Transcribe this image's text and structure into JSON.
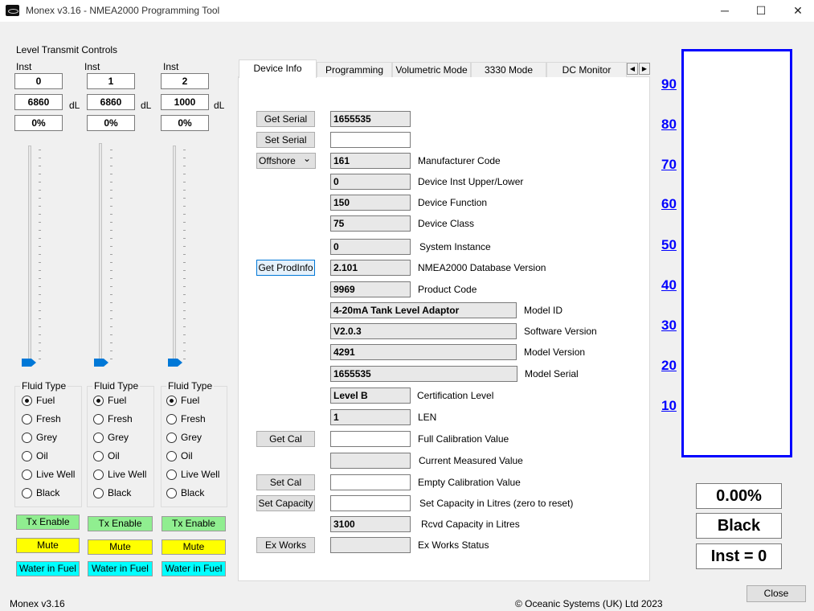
{
  "window": {
    "title": "Monex v3.16 - NMEA2000 Programming Tool",
    "minimize_glyph": "─",
    "maximize_glyph": "☐",
    "close_glyph": "✕"
  },
  "left": {
    "group_title": "Level Transmit Controls",
    "inst_label": "Inst",
    "unit_label": "dL",
    "fluid_type_label": "Fluid Type",
    "fluid_options": [
      "Fuel",
      "Fresh",
      "Grey",
      "Oil",
      "Live Well",
      "Black"
    ],
    "tx_enable_label": "Tx Enable",
    "mute_label": "Mute",
    "water_in_fuel_label": "Water in Fuel",
    "colors": {
      "tx_enable": "#90ee90",
      "mute": "#ffff00",
      "water_in_fuel": "#00ffff"
    },
    "channels": [
      {
        "inst": "0",
        "capacity": "6860",
        "level": "0%",
        "slider_fraction": 0,
        "fluid": "Fuel"
      },
      {
        "inst": "1",
        "capacity": "6860",
        "level": "0%",
        "slider_fraction": 0,
        "fluid": "Fuel"
      },
      {
        "inst": "2",
        "capacity": "1000",
        "level": "0%",
        "slider_fraction": 0,
        "fluid": "Fuel"
      }
    ]
  },
  "tabs": {
    "items": [
      "Device Info",
      "Programming",
      "Volumetric Mode",
      "3330 Mode",
      "DC Monitor"
    ],
    "active": "Device Info",
    "scroll_left": "◀",
    "scroll_right": "▶"
  },
  "device_info": {
    "buttons": {
      "get_serial": "Get Serial",
      "set_serial": "Set Serial",
      "get_prodinfo": "Get ProdInfo",
      "get_cal": "Get Cal",
      "set_cal": "Set Cal",
      "set_capacity": "Set Capacity",
      "ex_works": "Ex Works"
    },
    "industry_select": {
      "value": "Offshore",
      "arrow": "⌄"
    },
    "serial_value": "1655535",
    "set_serial_input": "",
    "manufacturer_code": {
      "value": "161",
      "label": "Manufacturer Code"
    },
    "device_inst": {
      "value": "0",
      "label": "Device Inst Upper/Lower"
    },
    "device_function": {
      "value": "150",
      "label": "Device Function"
    },
    "device_class": {
      "value": "75",
      "label": "Device Class"
    },
    "system_instance": {
      "value": "0",
      "label": "System Instance"
    },
    "db_version": {
      "value": "2.101",
      "label": "NMEA2000 Database Version"
    },
    "product_code": {
      "value": "9969",
      "label": "Product Code"
    },
    "model_id": {
      "value": "4-20mA Tank Level Adaptor",
      "label": "Model ID"
    },
    "software_version": {
      "value": "V2.0.3",
      "label": "Software Version"
    },
    "model_version": {
      "value": "4291",
      "label": "Model Version"
    },
    "model_serial": {
      "value": "1655535",
      "label": "Model Serial"
    },
    "certification_level": {
      "value": "Level B",
      "label": "Certification Level"
    },
    "len": {
      "value": "1",
      "label": "LEN"
    },
    "full_cal": {
      "value": "",
      "label": "Full Calibration Value"
    },
    "current_measured": {
      "value": "",
      "label": "Current Measured Value"
    },
    "empty_cal": {
      "value": "",
      "label": "Empty Calibration Value"
    },
    "set_capacity": {
      "value": "",
      "label": "Set Capacity in Litres (zero to reset)"
    },
    "rcvd_capacity": {
      "value": "3100",
      "label": "Rcvd Capacity in Litres"
    },
    "ex_works_status": {
      "value": "",
      "label": "Ex Works Status"
    }
  },
  "gauge": {
    "scale": [
      "90",
      "80",
      "70",
      "60",
      "50",
      "40",
      "30",
      "20",
      "10"
    ],
    "fill_fraction": 0,
    "border_color": "#0000ff",
    "percent_readout": "0.00%",
    "fluid_readout": "Black",
    "inst_readout": "Inst = 0"
  },
  "footer": {
    "version": "Monex v3.16",
    "copyright": "© Oceanic Systems (UK) Ltd 2023",
    "close_label": "Close"
  }
}
